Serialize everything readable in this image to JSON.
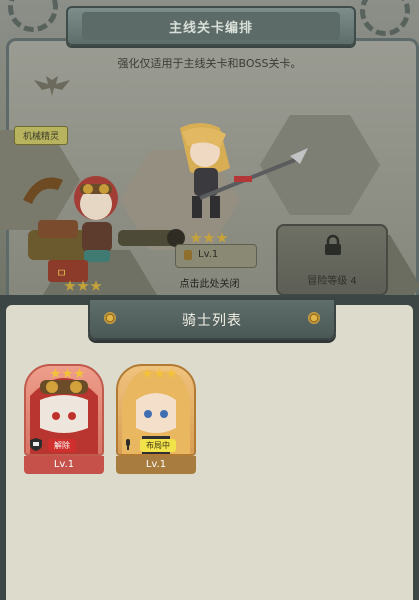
{
  "dialog": {
    "title": "主线关卡编排",
    "subtitle": "强化仅适用于主线关卡和BOSS关卡。",
    "close_hint": "点击此处关闭"
  },
  "scene": {
    "left_slot_name": "机械精灵",
    "left_slot_stars": 3,
    "right_slot_stars": 3,
    "right_slot_level": "Lv.1",
    "locked_slot": {
      "label": "冒险等级 4"
    }
  },
  "panel": {
    "title": "骑士列表",
    "cards": [
      {
        "stars": 3,
        "tag": "解除",
        "level": "Lv.1",
        "theme": "red"
      },
      {
        "stars": 3,
        "tag": "布局中",
        "level": "Lv.1",
        "theme": "gold"
      }
    ]
  },
  "colors": {
    "panel_bg": "#dddbcc",
    "panel_frame": "#3c4644",
    "card_red": "#c5514a",
    "card_gold": "#a87b3f",
    "star": "#f3c23a"
  }
}
